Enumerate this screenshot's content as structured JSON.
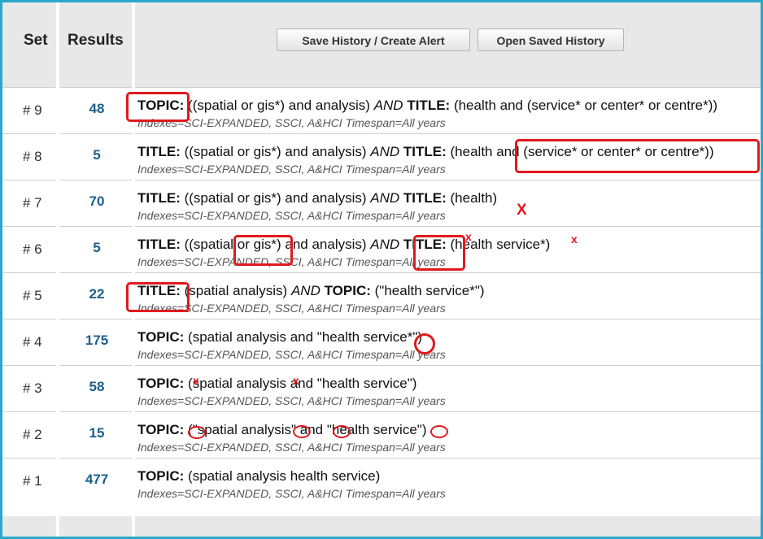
{
  "header": {
    "set_label": "Set",
    "results_label": "Results",
    "save_button": "Save History / Create Alert",
    "open_button": "Open Saved History"
  },
  "rows": [
    {
      "set": "# 9",
      "count": "48",
      "q": [
        "TOPIC:",
        " ((spatial or gis*) and analysis) ",
        "AND",
        " ",
        "TITLE:",
        " (health and (service* or center* or centre*))"
      ],
      "indexes": "Indexes=SCI-EXPANDED, SSCI, A&HCI Timespan=All years"
    },
    {
      "set": "# 8",
      "count": "5",
      "q": [
        "TITLE:",
        " ((spatial or gis*) and analysis) ",
        "AND",
        " ",
        "TITLE:",
        " (health and (service* or center* or centre*))"
      ],
      "indexes": "Indexes=SCI-EXPANDED, SSCI, A&HCI Timespan=All years"
    },
    {
      "set": "# 7",
      "count": "70",
      "q": [
        "TITLE:",
        " ((spatial or gis*) and analysis) ",
        "AND",
        " ",
        "TITLE:",
        " (health)"
      ],
      "indexes": "Indexes=SCI-EXPANDED, SSCI, A&HCI Timespan=All years"
    },
    {
      "set": "# 6",
      "count": "5",
      "q": [
        "TITLE:",
        " ((spatial or gis*) and analysis) ",
        "AND",
        " ",
        "TITLE:",
        " (health service*)"
      ],
      "indexes": "Indexes=SCI-EXPANDED, SSCI, A&HCI Timespan=All years"
    },
    {
      "set": "# 5",
      "count": "22",
      "q": [
        "TITLE:",
        " (spatial analysis) ",
        "AND",
        " ",
        "TOPIC:",
        " (\"health service*\")"
      ],
      "indexes": "Indexes=SCI-EXPANDED, SSCI, A&HCI Timespan=All years"
    },
    {
      "set": "# 4",
      "count": "175",
      "q": [
        "TOPIC:",
        " (spatial analysis and \"health service*\")",
        "",
        "",
        "",
        ""
      ],
      "indexes": "Indexes=SCI-EXPANDED, SSCI, A&HCI Timespan=All years"
    },
    {
      "set": "# 3",
      "count": "58",
      "q": [
        "TOPIC:",
        " (spatial analysis and \"health service\")",
        "",
        "",
        "",
        ""
      ],
      "indexes": "Indexes=SCI-EXPANDED, SSCI, A&HCI Timespan=All years"
    },
    {
      "set": "# 2",
      "count": "15",
      "q": [
        "TOPIC:",
        " (\"spatial analysis\" and \"health service\")",
        "",
        "",
        "",
        ""
      ],
      "indexes": "Indexes=SCI-EXPANDED, SSCI, A&HCI Timespan=All years"
    },
    {
      "set": "# 1",
      "count": "477",
      "q": [
        "TOPIC:",
        " (spatial analysis health service)",
        "",
        "",
        "",
        ""
      ],
      "indexes": "Indexes=SCI-EXPANDED, SSCI, A&HCI Timespan=All years"
    }
  ],
  "annotations": {
    "x_mark": "x",
    "x_mark_large": "X",
    "color": "#e0191e"
  },
  "colors": {
    "frame": "#2aa7c9",
    "count_link": "#1a5f8c"
  }
}
